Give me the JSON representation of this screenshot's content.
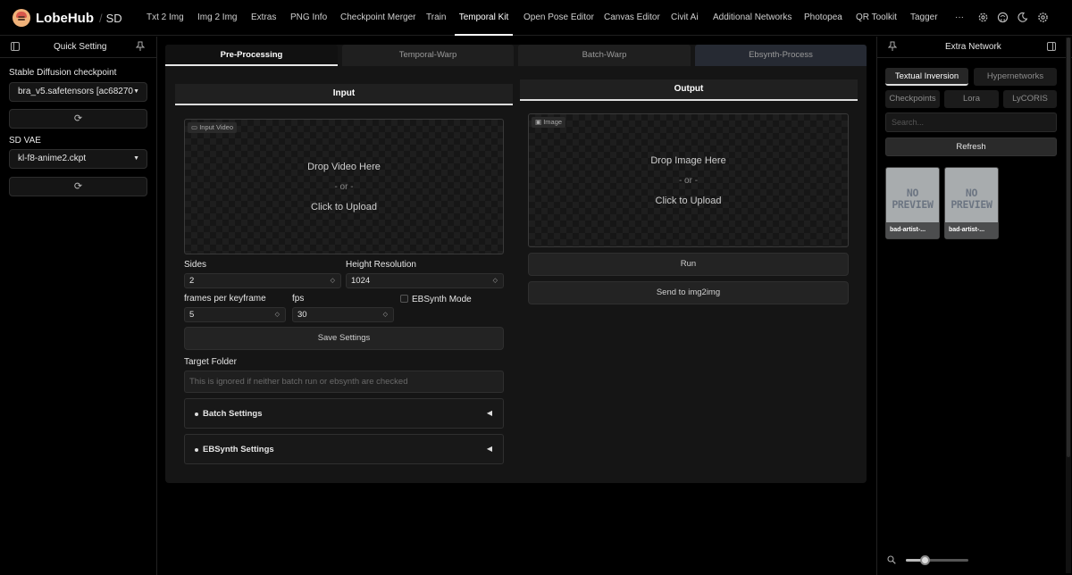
{
  "brand": {
    "name": "LobeHub",
    "sep": "/",
    "sub": "SD"
  },
  "nav": {
    "tabs": [
      "Txt 2 Img",
      "Img 2 Img",
      "Extras",
      "PNG Info",
      "Checkpoint Merger",
      "Train",
      "Temporal Kit",
      "Open Pose Editor",
      "Canvas Editor",
      "Civit Ai",
      "Additional Networks",
      "Photopea",
      "QR Toolkit",
      "Tagger"
    ],
    "active": "Temporal Kit",
    "more": "···"
  },
  "quick": {
    "title": "Quick Setting",
    "checkpoint_label": "Stable Diffusion checkpoint",
    "checkpoint_value": "bra_v5.safetensors [ac68270",
    "vae_label": "SD VAE",
    "vae_value": "kl-f8-anime2.ckpt"
  },
  "proc_tabs": [
    "Pre-Processing",
    "Temporal-Warp",
    "Batch-Warp",
    "Ebsynth-Process"
  ],
  "input": {
    "header": "Input",
    "video_tag": "Input Video",
    "drop": "Drop Video Here",
    "or": "- or -",
    "click": "Click to Upload",
    "sides_label": "Sides",
    "sides_value": "2",
    "height_label": "Height Resolution",
    "height_value": "1024",
    "fpk_label": "frames per keyframe",
    "fpk_value": "5",
    "fps_label": "fps",
    "fps_value": "30",
    "ebsynth_label": "EBSynth Mode",
    "save_label": "Save Settings",
    "target_label": "Target Folder",
    "target_placeholder": "This is ignored if neither batch run or ebsynth are checked",
    "batch_settings": "Batch Settings",
    "ebsynth_settings": "EBSynth Settings"
  },
  "output": {
    "header": "Output",
    "image_tag": "Image",
    "drop": "Drop Image Here",
    "or": "- or -",
    "click": "Click to Upload",
    "run": "Run",
    "send": "Send to img2img"
  },
  "extra": {
    "title": "Extra Network",
    "tabs_row1": [
      "Textual Inversion",
      "Hypernetworks"
    ],
    "tabs_row2": [
      "Checkpoints",
      "Lora",
      "LyCORIS"
    ],
    "search_placeholder": "Search...",
    "refresh": "Refresh",
    "cards": [
      {
        "preview": "NO\nPREVIEW",
        "name": "bad-artist-..."
      },
      {
        "preview": "NO\nPREVIEW",
        "name": "bad-artist-..."
      }
    ],
    "zoom_level": 0.3
  }
}
